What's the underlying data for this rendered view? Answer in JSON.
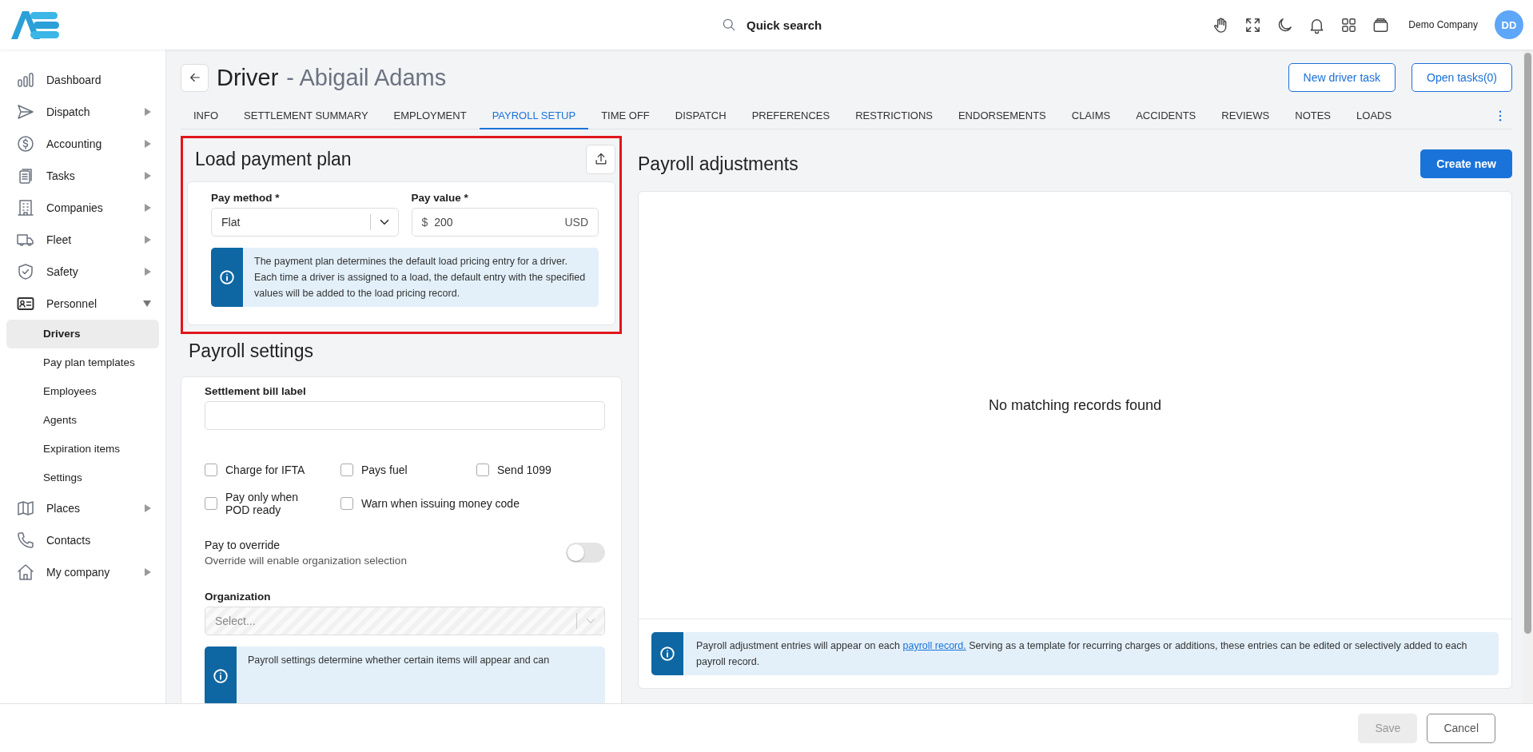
{
  "header": {
    "search_label": "Quick search",
    "company": "Demo Company",
    "avatar_initials": "DD"
  },
  "sidebar": {
    "items": [
      {
        "label": "Dashboard",
        "kind": "link"
      },
      {
        "label": "Dispatch",
        "kind": "group",
        "expanded": false
      },
      {
        "label": "Accounting",
        "kind": "group",
        "expanded": false
      },
      {
        "label": "Tasks",
        "kind": "group",
        "expanded": false
      },
      {
        "label": "Companies",
        "kind": "group",
        "expanded": false
      },
      {
        "label": "Fleet",
        "kind": "group",
        "expanded": false
      },
      {
        "label": "Safety",
        "kind": "group",
        "expanded": false
      },
      {
        "label": "Personnel",
        "kind": "group",
        "expanded": true,
        "children": [
          {
            "label": "Drivers",
            "selected": true
          },
          {
            "label": "Pay plan templates",
            "selected": false
          },
          {
            "label": "Employees",
            "selected": false
          },
          {
            "label": "Agents",
            "selected": false
          },
          {
            "label": "Expiration items",
            "selected": false
          },
          {
            "label": "Settings",
            "selected": false
          }
        ]
      },
      {
        "label": "Places",
        "kind": "group",
        "expanded": false
      },
      {
        "label": "Contacts",
        "kind": "link"
      },
      {
        "label": "My company",
        "kind": "group",
        "expanded": false
      }
    ]
  },
  "page": {
    "title": "Driver",
    "subtitle": "- Abigail Adams",
    "buttons": [
      "New driver task",
      "Open tasks(0)"
    ]
  },
  "tabs": [
    {
      "label": "INFO",
      "selected": false
    },
    {
      "label": "SETTLEMENT SUMMARY",
      "selected": false
    },
    {
      "label": "EMPLOYMENT",
      "selected": false
    },
    {
      "label": "PAYROLL SETUP",
      "selected": true
    },
    {
      "label": "TIME OFF",
      "selected": false
    },
    {
      "label": "DISPATCH",
      "selected": false
    },
    {
      "label": "PREFERENCES",
      "selected": false
    },
    {
      "label": "RESTRICTIONS",
      "selected": false
    },
    {
      "label": "ENDORSEMENTS",
      "selected": false
    },
    {
      "label": "CLAIMS",
      "selected": false
    },
    {
      "label": "ACCIDENTS",
      "selected": false
    },
    {
      "label": "REVIEWS",
      "selected": false
    },
    {
      "label": "NOTES",
      "selected": false
    },
    {
      "label": "LOADS",
      "selected": false
    }
  ],
  "load_payment_plan": {
    "title": "Load payment plan",
    "highlighted": true,
    "pay_method": {
      "label": "Pay method *",
      "value": "Flat"
    },
    "pay_value": {
      "label": "Pay value *",
      "prefix": "$",
      "value": "200",
      "suffix": "USD"
    },
    "info": "The payment plan determines the default load pricing entry for a driver. Each time a driver is assigned to a load, the default entry with the specified values will be added to the load pricing record."
  },
  "payroll_settings": {
    "title": "Payroll settings",
    "settlement_bill_label": {
      "label": "Settlement bill label"
    },
    "checkboxes": [
      {
        "label": "Charge for IFTA",
        "checked": false
      },
      {
        "label": "Pays fuel",
        "checked": false
      },
      {
        "label": "Send 1099",
        "checked": false
      },
      {
        "label": "Pay only when POD ready",
        "checked": false
      },
      {
        "label": "Warn when issuing money code",
        "checked": false
      }
    ],
    "pay_to_override": {
      "label": "Pay to override",
      "description": "Override will enable organization selection",
      "on": false
    },
    "organization": {
      "label": "Organization",
      "placeholder": "Select...",
      "disabled": true
    },
    "info": "Payroll settings determine whether certain items will appear and can"
  },
  "payroll_adjustments": {
    "title": "Payroll adjustments",
    "create_button": "Create new",
    "empty_text": "No matching records found",
    "info": {
      "before": "Payroll adjustment entries will appear on each ",
      "link": "payroll record.",
      "after": " Serving as a template for recurring charges or additions, these entries can be edited or selectively added to each payroll record."
    }
  },
  "footer": {
    "buttons": [
      {
        "label": "Save",
        "disabled": true
      },
      {
        "label": "Cancel",
        "disabled": false
      }
    ]
  }
}
